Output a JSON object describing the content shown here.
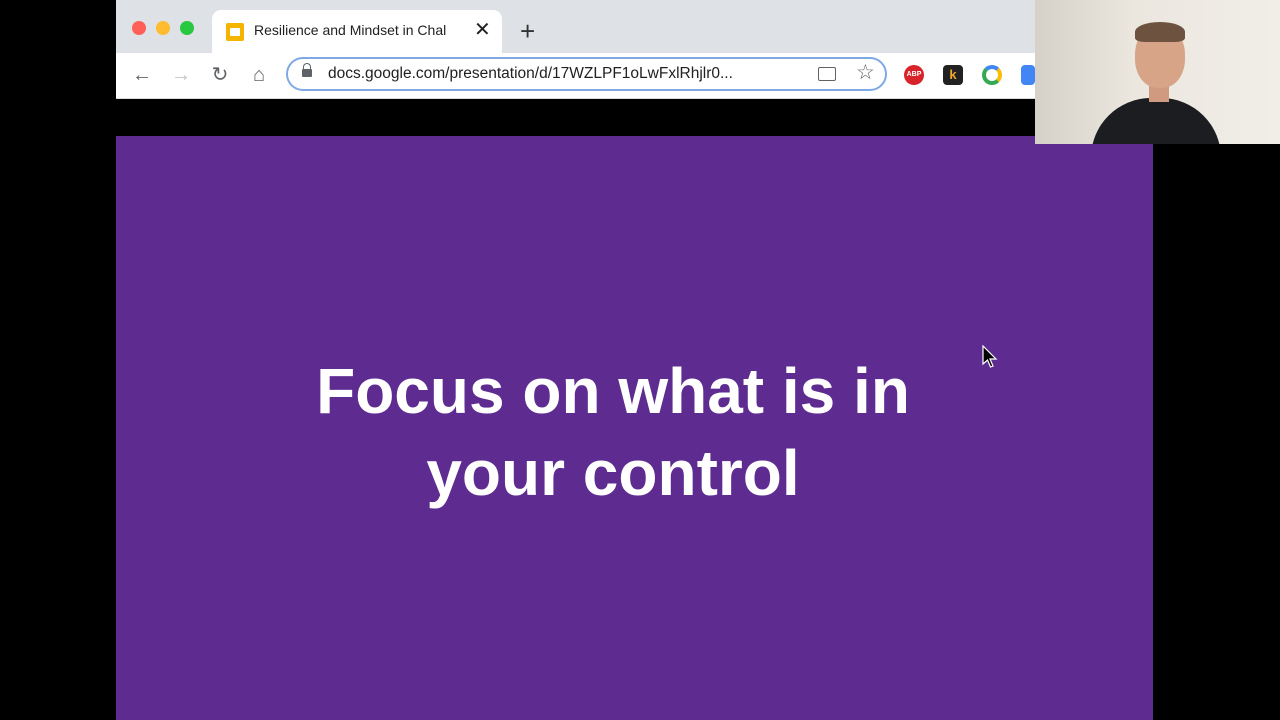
{
  "browser": {
    "tab": {
      "title": "Resilience and Mindset in Chal",
      "close_label": "✕",
      "icon": "google-slides-icon"
    },
    "new_tab_label": "+",
    "toolbar": {
      "back_icon": "←",
      "forward_icon": "→",
      "reload_icon": "↻",
      "home_icon": "⌂",
      "url": "docs.google.com/presentation/d/17WZLPF1oLwFxlRhjlr0...",
      "star_icon": "☆",
      "extensions": [
        {
          "name": "adblock-plus-icon",
          "label": "ABP",
          "color": "#d8232a"
        },
        {
          "name": "k-extension-icon",
          "label": "k",
          "color": "#222222"
        },
        {
          "name": "circle-extension-icon",
          "label": ""
        },
        {
          "name": "cut-off-extension-icon",
          "label": ""
        }
      ]
    },
    "traffic_lights": {
      "close": "#ff5f57",
      "minimize": "#febc2e",
      "maximize": "#28c840"
    }
  },
  "slide": {
    "title_line1": "Focus on what is in",
    "title_line2": "your control",
    "background": "#5e2b91",
    "text_color": "#ffffff"
  },
  "webcam": {
    "subject": "presenter-video"
  }
}
